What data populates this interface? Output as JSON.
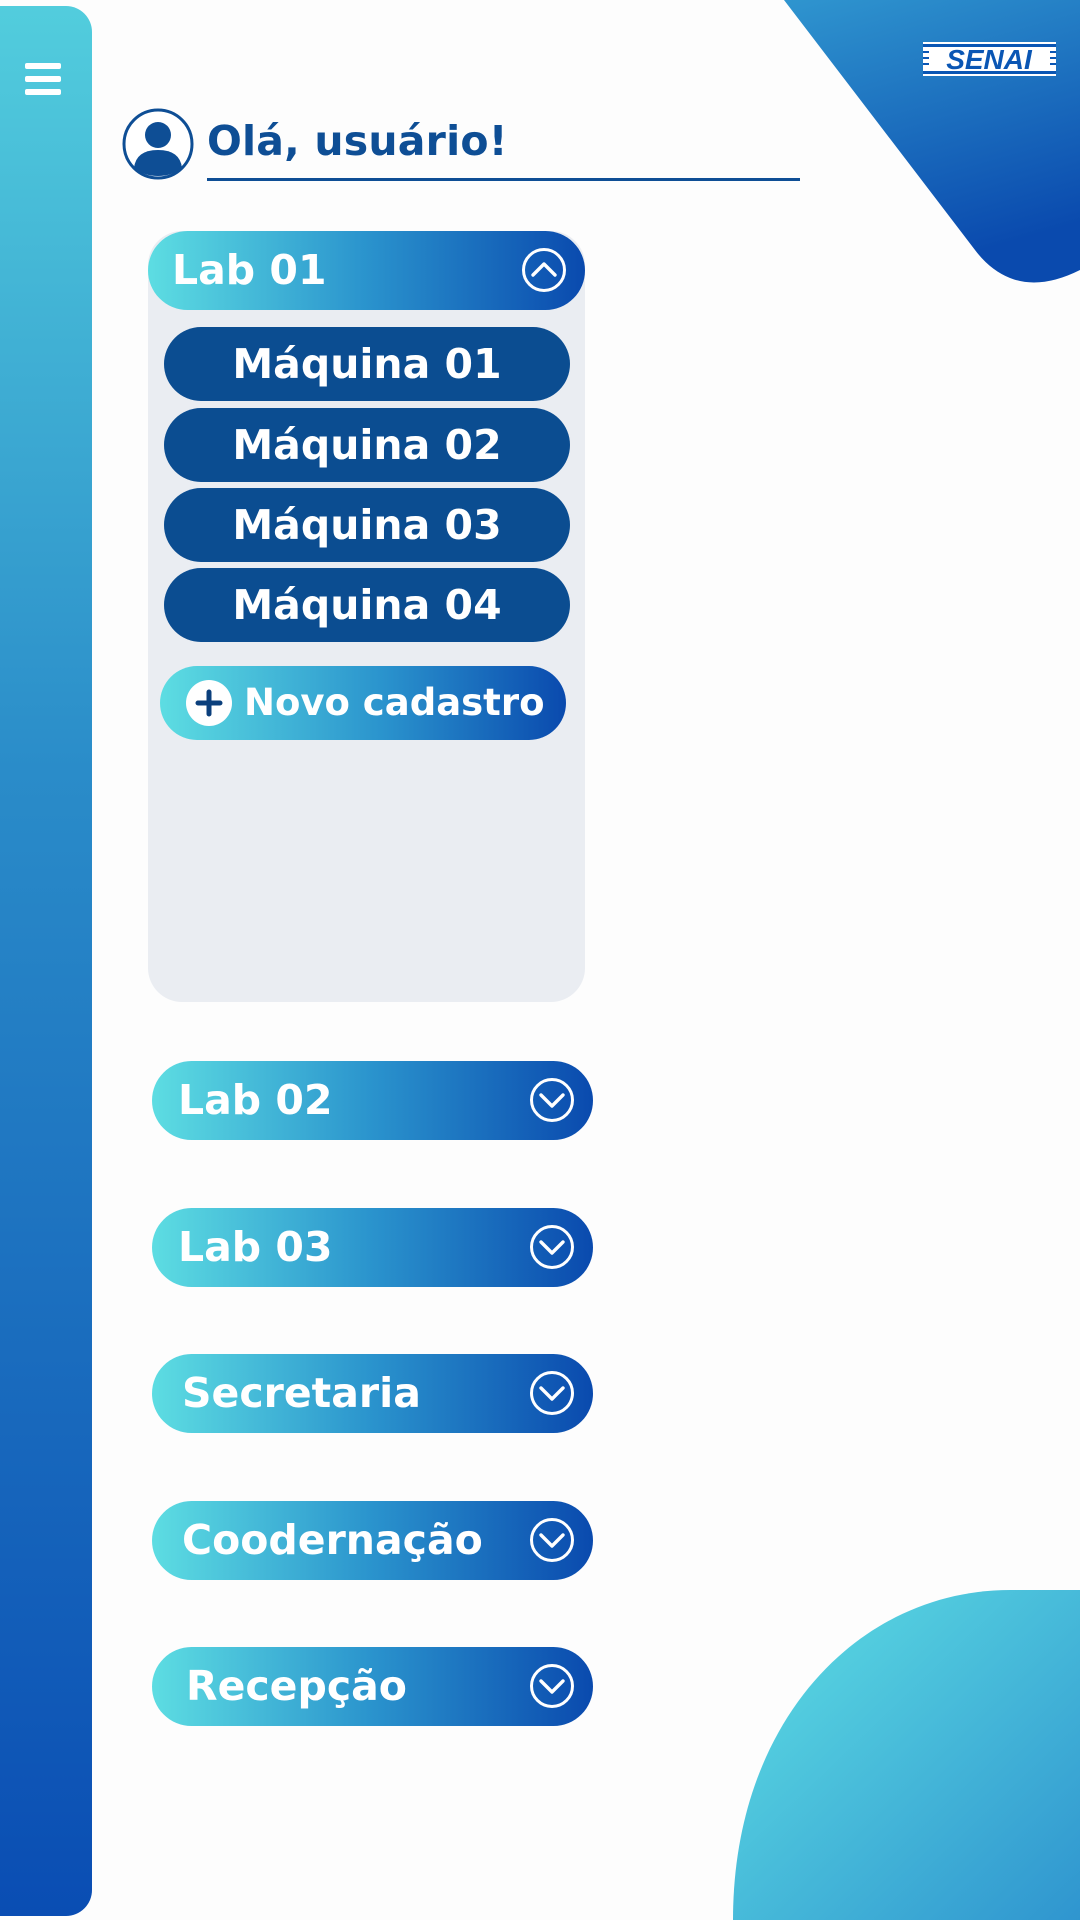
{
  "header": {
    "logo_text": "SENAI",
    "greeting": "Olá, usuário!"
  },
  "icons": {
    "menu": "hamburger-menu-icon",
    "avatar": "user-avatar-icon",
    "expanded": "chevron-up-circle-icon",
    "collapsed": "chevron-down-circle-icon",
    "add": "plus-circle-icon"
  },
  "sections": [
    {
      "label": "Lab 01",
      "expanded": true,
      "items": [
        "Máquina 01",
        "Máquina 02",
        "Máquina 03",
        "Máquina 04"
      ],
      "new_button": "Novo cadastro"
    },
    {
      "label": "Lab 02",
      "expanded": false
    },
    {
      "label": "Lab 03",
      "expanded": false
    },
    {
      "label": "Secretaria",
      "expanded": false
    },
    {
      "label": "Coodernação",
      "expanded": false
    },
    {
      "label": "Recepção",
      "expanded": false
    }
  ],
  "colors": {
    "primary_dark": "#0b4d91",
    "gradient_light": "#5ddde2",
    "gradient_dark": "#0a4aae",
    "panel_bg": "#eaedf2"
  }
}
